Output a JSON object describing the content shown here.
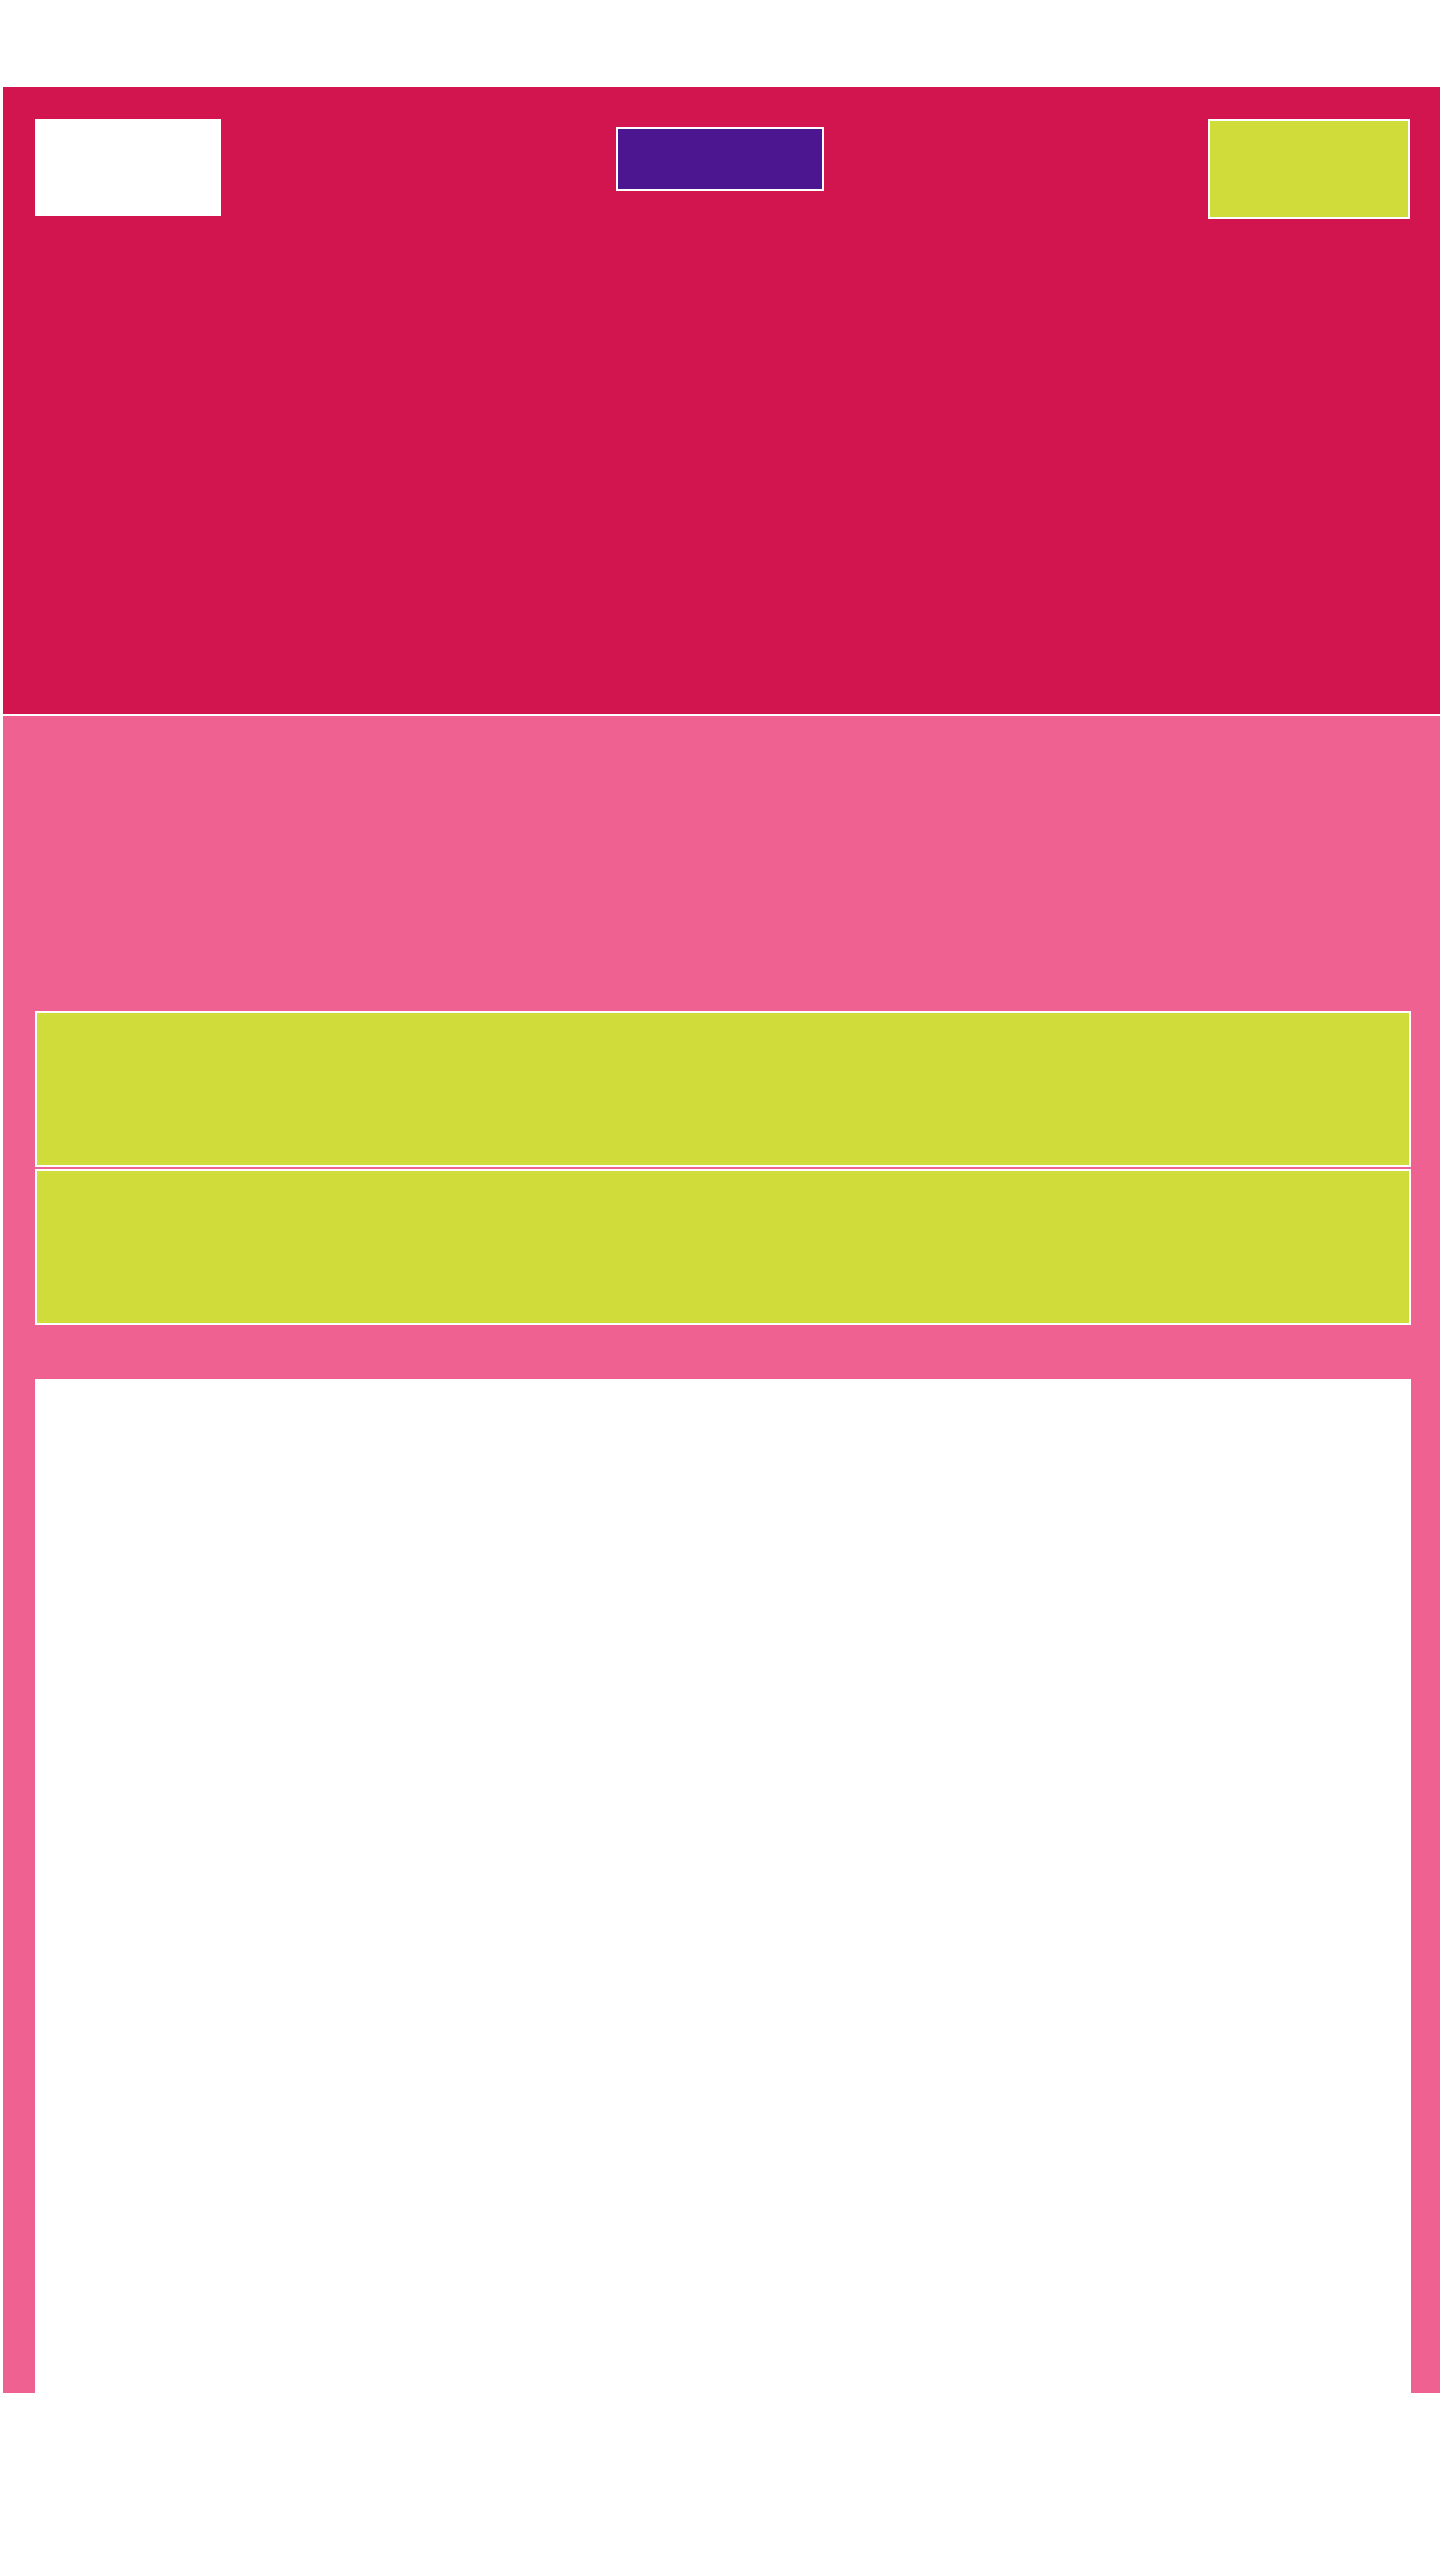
{
  "colors": {
    "header_background": "#d2154f",
    "content_background": "#ef6190",
    "logo_background": "#ffffff",
    "nav_button_background": "#4b168f",
    "accent_background": "#cfdc3a",
    "panel_background": "#ffffff",
    "border": "#ffffff"
  },
  "header": {
    "logo_label": "",
    "nav_label": "",
    "menu_label": ""
  },
  "main": {
    "bars": [
      {
        "label": ""
      },
      {
        "label": ""
      }
    ],
    "panel_label": ""
  }
}
